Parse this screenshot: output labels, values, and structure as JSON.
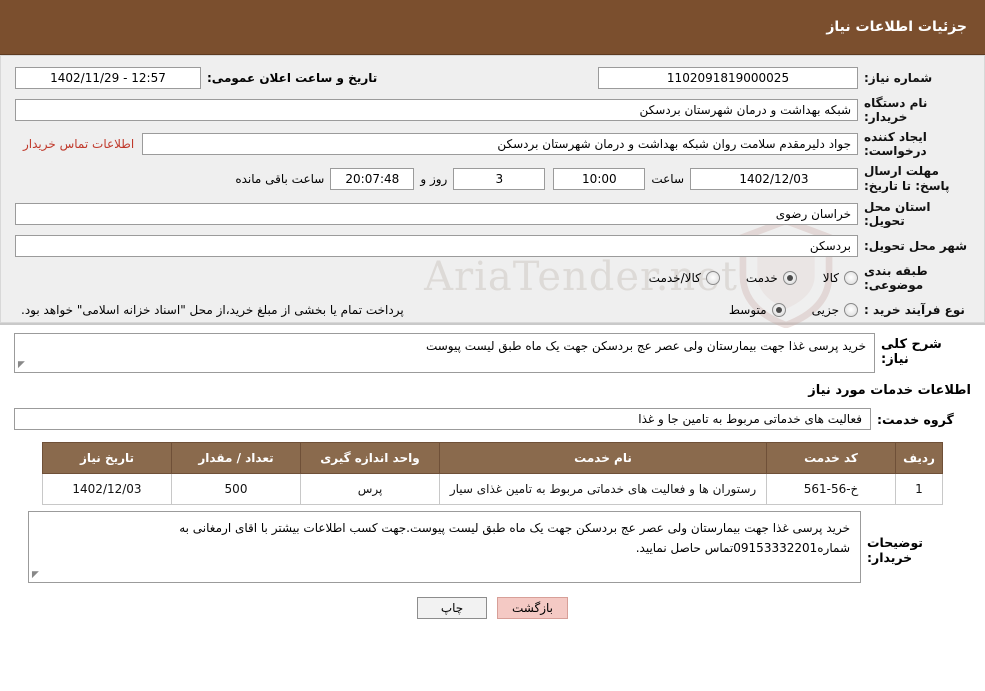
{
  "header": {
    "title": "جزئیات اطلاعات نیاز"
  },
  "form": {
    "need_number_label": "شماره نیاز:",
    "need_number_value": "1102091819000025",
    "announce_datetime_label": "تاریخ و ساعت اعلان عمومی:",
    "announce_datetime_value": "12:57 - 1402/11/29",
    "buyer_org_label": "نام دستگاه خریدار:",
    "buyer_org_value": "شبکه بهداشت و درمان شهرستان بردسکن",
    "requester_label": "ایجاد کننده درخواست:",
    "requester_value": "جواد دلیرمقدم سلامت روان شبکه بهداشت و درمان شهرستان بردسکن",
    "contact_link": "اطلاعات تماس خریدار",
    "deadline_label": "مهلت ارسال پاسخ: تا تاریخ:",
    "deadline_date": "1402/12/03",
    "hour_label": "ساعت",
    "hour_value": "10:00",
    "days_value": "3",
    "days_label": "روز و",
    "remaining_time": "20:07:48",
    "remaining_label": "ساعت باقی مانده",
    "province_label": "استان محل تحویل:",
    "province_value": "خراسان رضوی",
    "city_label": "شهر محل تحویل:",
    "city_value": "بردسکن",
    "category_label": "طبقه بندی موضوعی:",
    "category_options": [
      "کالا",
      "خدمت",
      "کالا/خدمت"
    ],
    "category_selected": "خدمت",
    "process_label": "نوع فرآیند خرید :",
    "process_options": [
      "جزیی",
      "متوسط"
    ],
    "process_selected": "متوسط",
    "process_note": "پرداخت تمام یا بخشی از مبلغ خرید،از محل \"اسناد خزانه اسلامی\" خواهد بود."
  },
  "summary": {
    "label": "شرح کلی نیاز:",
    "value": "خرید پرسی غذا جهت بیمارستان ولی عصر عج بردسکن جهت یک ماه طبق لیست پیوست"
  },
  "services": {
    "section_title": "اطلاعات خدمات مورد نیاز",
    "group_label": "گروه خدمت:",
    "group_value": "فعالیت های خدماتی مربوط به تامین جا و غذا",
    "columns": [
      "ردیف",
      "کد خدمت",
      "نام خدمت",
      "واحد اندازه گیری",
      "تعداد / مقدار",
      "تاریخ نیاز"
    ],
    "rows": [
      {
        "index": "1",
        "code": "خ-56-561",
        "name": "رستوران ها و فعالیت های خدماتی مربوط به تامین غذای سیار",
        "unit": "پرس",
        "quantity": "500",
        "date": "1402/12/03"
      }
    ]
  },
  "buyer_notes": {
    "label": "توضیحات خریدار:",
    "value": "خرید پرسی غذا جهت بیمارستان ولی عصر عج بردسکن جهت یک ماه طبق لیست پیوست.جهت کسب اطلاعات بیشتر با اقای ارمغانی به شماره09153332201تماس حاصل نمایید."
  },
  "footer": {
    "print_label": "چاپ",
    "back_label": "بازگشت"
  },
  "watermark": {
    "text": "AriaTender.net"
  },
  "colors": {
    "header_bg": "#7b4f2e",
    "table_header_bg": "#8a6a4d",
    "link": "#c0392b",
    "back_button": "#f4c9c4"
  }
}
